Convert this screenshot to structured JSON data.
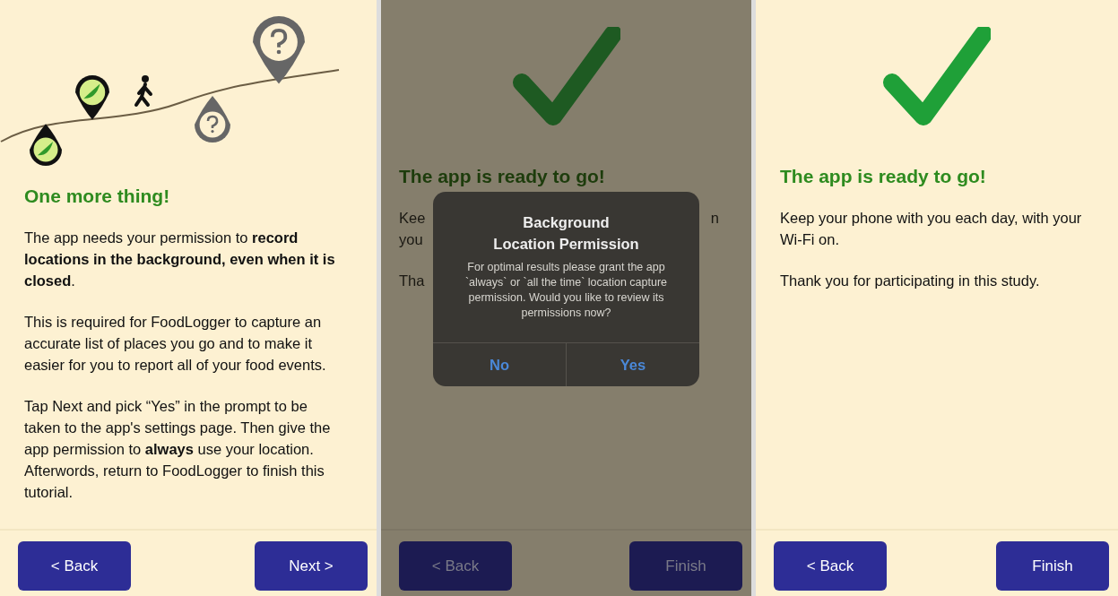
{
  "panels": [
    {
      "kind": "illustration",
      "dimmed": false,
      "heading": "One more thing!",
      "paragraphs": [
        "The app needs your permission to **record locations in the background, even when it is closed**.",
        "This is required for FoodLogger to capture an accurate list of places you go and to make it easier for you to report all of your food events.",
        "Tap Next and pick “Yes” in the prompt to be taken to the app's settings page. Then give the app permission to **always** use your location. Afterwords, return to FoodLogger to finish this tutorial."
      ],
      "buttons": [
        {
          "label": "< Back"
        },
        {
          "label": "Next >"
        }
      ]
    },
    {
      "kind": "check",
      "dimmed": true,
      "heading": "The app is ready to go!",
      "fragments": [
        {
          "left": "Kee",
          "right": "n"
        },
        {
          "left": "you"
        },
        {
          "left": "Tha"
        }
      ],
      "dialog": {
        "title": "Background\nLocation Permission",
        "message": "For optimal results please grant the app `always` or `all the time` location capture permission.  Would you like to review its permissions now?",
        "actions": [
          {
            "label": "No"
          },
          {
            "label": "Yes"
          }
        ]
      },
      "buttons": [
        {
          "label": "< Back"
        },
        {
          "label": "Finish"
        }
      ]
    },
    {
      "kind": "check",
      "dimmed": false,
      "heading": "The app is ready to go!",
      "paragraphs": [
        "Keep your phone with you each day, with your Wi-Fi on.",
        "Thank you for participating in this study."
      ],
      "buttons": [
        {
          "label": "< Back"
        },
        {
          "label": "Finish"
        }
      ]
    }
  ]
}
